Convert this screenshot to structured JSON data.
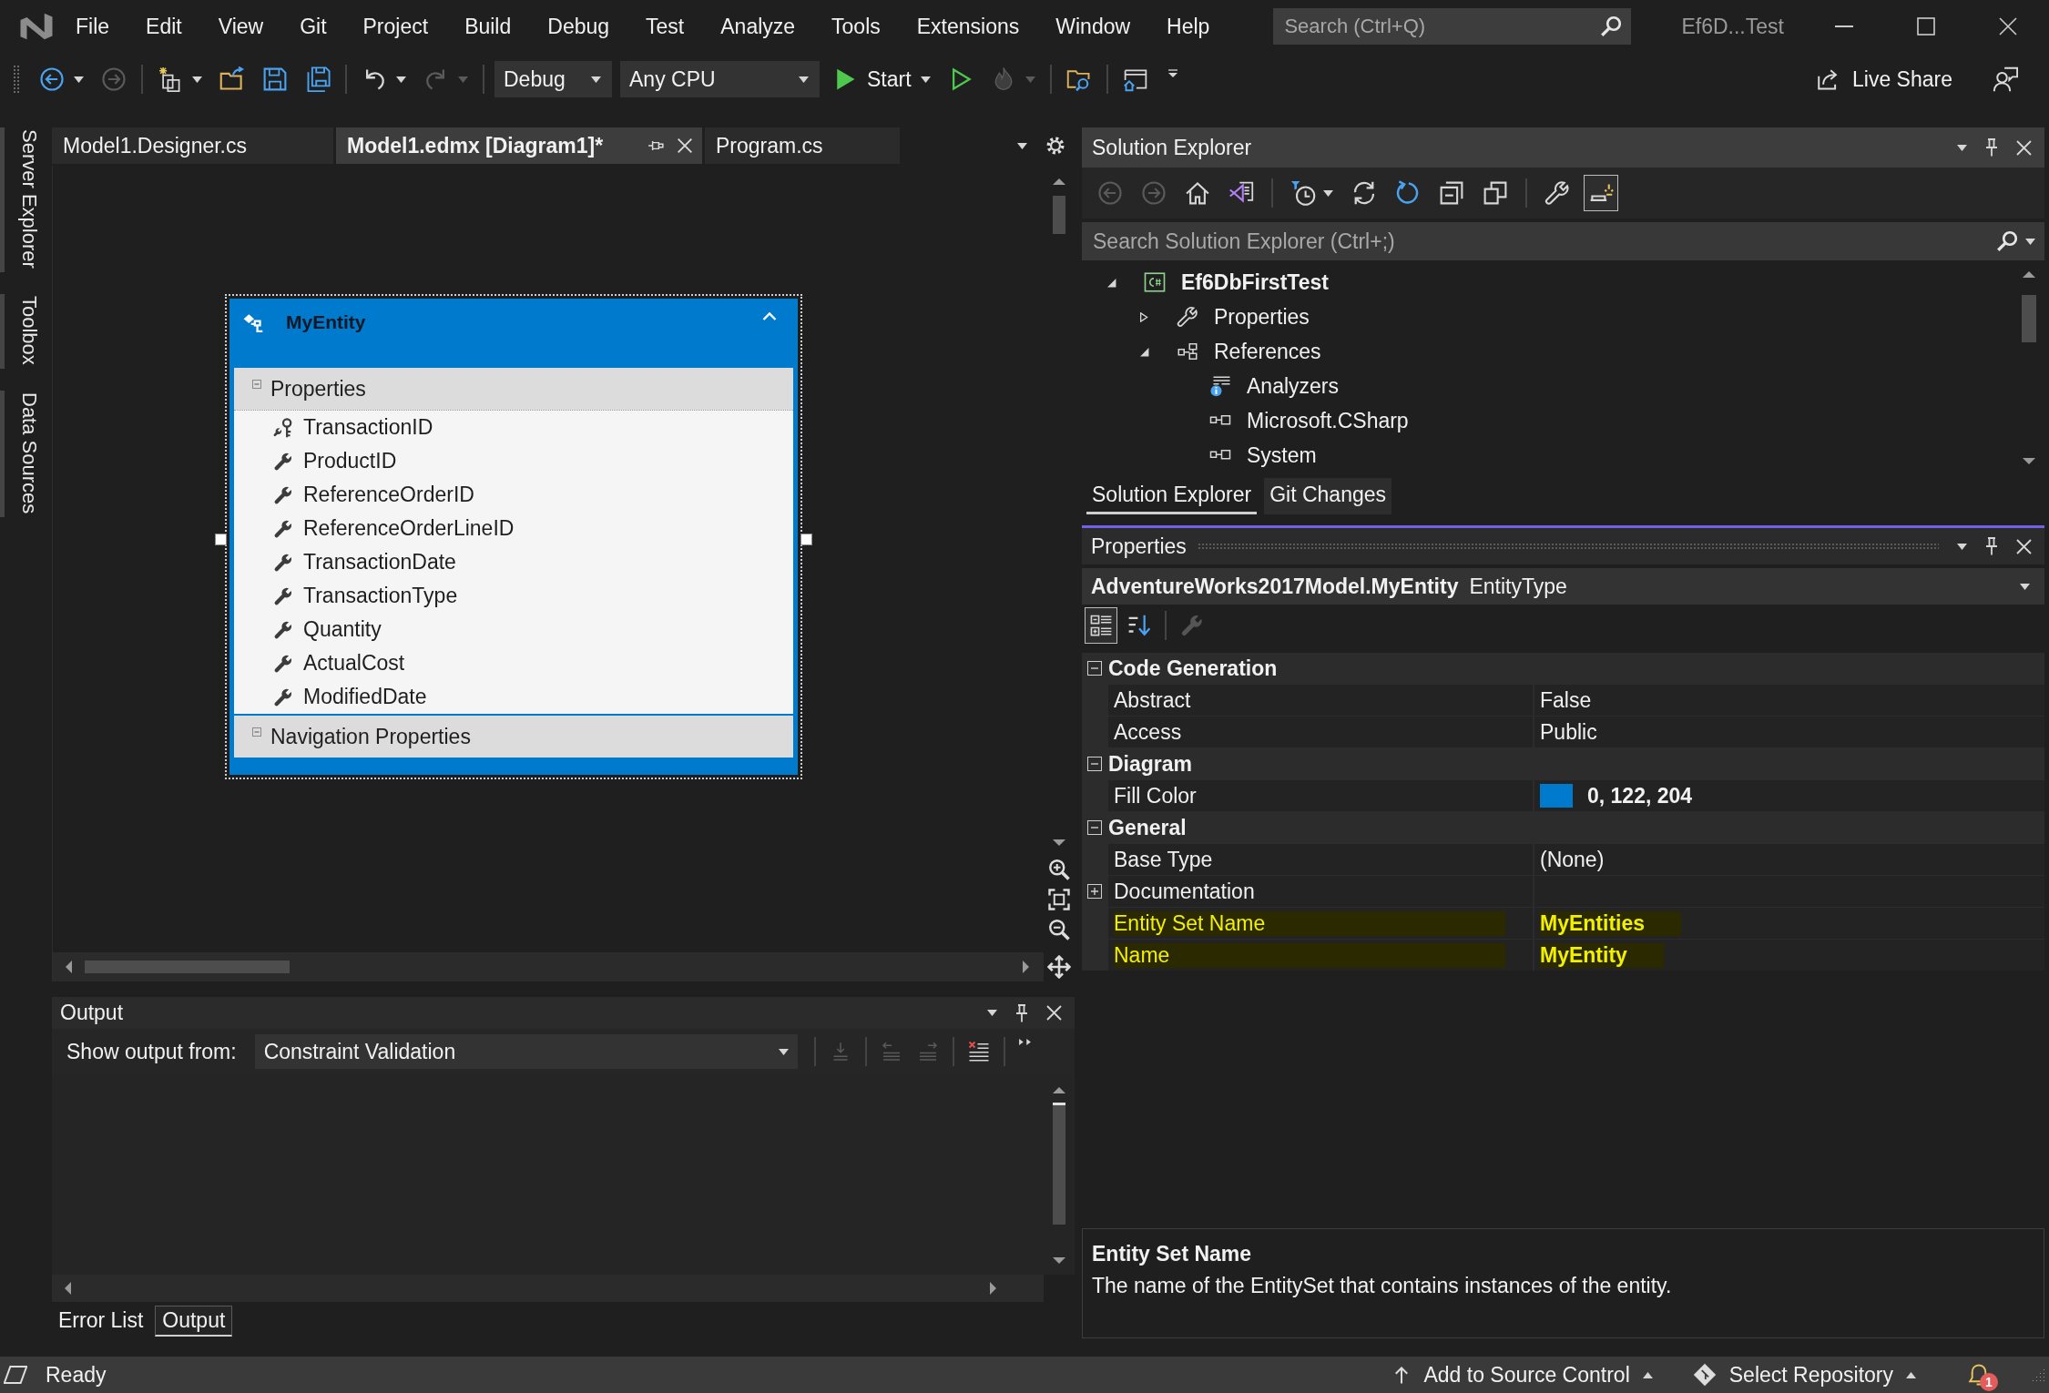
{
  "title_bar": {
    "menu": [
      "File",
      "Edit",
      "View",
      "Git",
      "Project",
      "Build",
      "Debug",
      "Test",
      "Analyze",
      "Tools",
      "Extensions",
      "Window",
      "Help"
    ],
    "search": {
      "placeholder": "Search (Ctrl+Q)"
    },
    "solution_name": "Ef6D...Test"
  },
  "toolbar": {
    "items": [
      {
        "kind": "back",
        "disabled": false,
        "split": true
      },
      {
        "kind": "forward",
        "disabled": true,
        "split": false
      },
      {
        "kind": "separator"
      },
      {
        "kind": "new-item",
        "disabled": false,
        "split": true
      },
      {
        "kind": "open",
        "disabled": false,
        "split": false
      },
      {
        "kind": "save",
        "disabled": false,
        "split": false
      },
      {
        "kind": "save-all",
        "disabled": false,
        "split": false
      },
      {
        "kind": "separator"
      },
      {
        "kind": "undo",
        "disabled": false,
        "split": true
      },
      {
        "kind": "redo",
        "disabled": true,
        "split": true
      },
      {
        "kind": "separator"
      },
      {
        "kind": "combo",
        "value": "Debug"
      },
      {
        "kind": "combo",
        "value": "Any CPU"
      },
      {
        "kind": "start",
        "label": "Start",
        "disabled": false,
        "split": true
      },
      {
        "kind": "run",
        "disabled": false,
        "split": false
      },
      {
        "kind": "hot-reload",
        "disabled": true,
        "split": true
      },
      {
        "kind": "separator"
      },
      {
        "kind": "find-folder",
        "disabled": false,
        "split": false
      },
      {
        "kind": "separator"
      },
      {
        "kind": "window",
        "disabled": false,
        "split": false
      },
      {
        "kind": "overflow"
      }
    ],
    "live_share": "Live Share"
  },
  "side_tabs": [
    "Server Explorer",
    "Toolbox",
    "Data Sources"
  ],
  "document_tabs": [
    {
      "label": "Model1.Designer.cs",
      "selected": false
    },
    {
      "label": "Model1.edmx [Diagram1]*",
      "selected": true
    },
    {
      "label": "Program.cs",
      "selected": false
    }
  ],
  "diagram": {
    "entities": [
      {
        "name": "MyEntity",
        "color": "#007acc",
        "selected": true,
        "expanded": true,
        "sections": [
          {
            "title": "Properties",
            "expanded": true,
            "items": [
              {
                "name": "TransactionID",
                "kind": "key"
              },
              {
                "name": "ProductID",
                "kind": "scalar"
              },
              {
                "name": "ReferenceOrderID",
                "kind": "scalar"
              },
              {
                "name": "ReferenceOrderLineID",
                "kind": "scalar"
              },
              {
                "name": "TransactionDate",
                "kind": "scalar"
              },
              {
                "name": "TransactionType",
                "kind": "scalar"
              },
              {
                "name": "Quantity",
                "kind": "scalar"
              },
              {
                "name": "ActualCost",
                "kind": "scalar"
              },
              {
                "name": "ModifiedDate",
                "kind": "scalar"
              }
            ]
          },
          {
            "title": "Navigation Properties",
            "expanded": true
          }
        ]
      }
    ]
  },
  "output": {
    "title": "Output",
    "source_label": "Show output from:",
    "source": "Constraint Validation",
    "toolbar": [
      {
        "kind": "separator"
      },
      {
        "kind": "find-in-code",
        "disabled": true
      },
      {
        "kind": "separator"
      },
      {
        "kind": "previous",
        "disabled": true
      },
      {
        "kind": "next",
        "disabled": true
      },
      {
        "kind": "separator"
      },
      {
        "kind": "clear",
        "disabled": false
      },
      {
        "kind": "separator"
      },
      {
        "kind": "more"
      }
    ],
    "tabs": [
      {
        "label": "Error List",
        "selected": false
      },
      {
        "label": "Output",
        "selected": true
      }
    ]
  },
  "solution_explorer": {
    "title": "Solution Explorer",
    "toolbar": [
      {
        "kind": "back",
        "disabled": true
      },
      {
        "kind": "forward",
        "disabled": true
      },
      {
        "kind": "home",
        "disabled": false
      },
      {
        "kind": "switch-views",
        "disabled": false
      },
      {
        "kind": "separator"
      },
      {
        "kind": "pending-changes",
        "disabled": false,
        "split": true
      },
      {
        "kind": "sync",
        "disabled": false
      },
      {
        "kind": "refresh",
        "disabled": false
      },
      {
        "kind": "collapse-all",
        "disabled": false
      },
      {
        "kind": "show-all",
        "disabled": false
      },
      {
        "kind": "separator"
      },
      {
        "kind": "properties",
        "disabled": false
      },
      {
        "kind": "preview",
        "disabled": false,
        "toggled": true
      }
    ],
    "search": {
      "placeholder": "Search Solution Explorer (Ctrl+;)"
    },
    "tree": [
      {
        "label": "Ef6DbFirstTest",
        "kind": "csharp-project",
        "expanded": true,
        "children": [
          {
            "label": "Properties",
            "kind": "properties",
            "expanded": false
          },
          {
            "label": "References",
            "kind": "references",
            "expanded": true,
            "children": [
              {
                "label": "Analyzers",
                "kind": "analyzers"
              },
              {
                "label": "Microsoft.CSharp",
                "kind": "reference"
              },
              {
                "label": "System",
                "kind": "reference"
              }
            ]
          }
        ]
      }
    ],
    "tabs": [
      {
        "label": "Solution Explorer",
        "selected": true
      },
      {
        "label": "Git Changes",
        "selected": false
      }
    ]
  },
  "properties": {
    "title": "Properties",
    "object": {
      "name": "AdventureWorks2017Model.MyEntity",
      "type": "EntityType"
    },
    "toolbar": [
      {
        "kind": "categorized",
        "selected": true
      },
      {
        "kind": "alphabetical",
        "selected": false
      },
      {
        "kind": "separator"
      },
      {
        "kind": "property-pages",
        "disabled": true
      }
    ],
    "categories": [
      {
        "title": "Code Generation",
        "expanded": true,
        "rows": [
          {
            "name": "Abstract",
            "kind": "text",
            "value": "False",
            "modified": false,
            "highlighted": false
          },
          {
            "name": "Access",
            "kind": "text",
            "value": "Public",
            "modified": false,
            "highlighted": false
          }
        ]
      },
      {
        "title": "Diagram",
        "expanded": true,
        "rows": [
          {
            "name": "Fill Color",
            "kind": "color",
            "color": "#007acc",
            "value": "0, 122, 204",
            "modified": true,
            "highlighted": false
          }
        ]
      },
      {
        "title": "General",
        "expanded": true,
        "rows": [
          {
            "name": "Base Type",
            "kind": "text",
            "value": "(None)",
            "modified": false,
            "highlighted": false
          },
          {
            "name": "Documentation",
            "kind": "group",
            "expanded": false,
            "highlighted": false
          },
          {
            "name": "Entity Set Name",
            "kind": "text",
            "value": "MyEntities",
            "modified": true,
            "highlighted": true
          },
          {
            "name": "Name",
            "kind": "text",
            "value": "MyEntity",
            "modified": true,
            "highlighted": true
          }
        ]
      }
    ],
    "description": {
      "title": "Entity Set Name",
      "text": "The name of the EntitySet that contains instances of the entity."
    }
  },
  "status_bar": {
    "text": "Ready",
    "source_control": "Add to Source Control",
    "repository": "Select Repository",
    "notifications": "1"
  }
}
